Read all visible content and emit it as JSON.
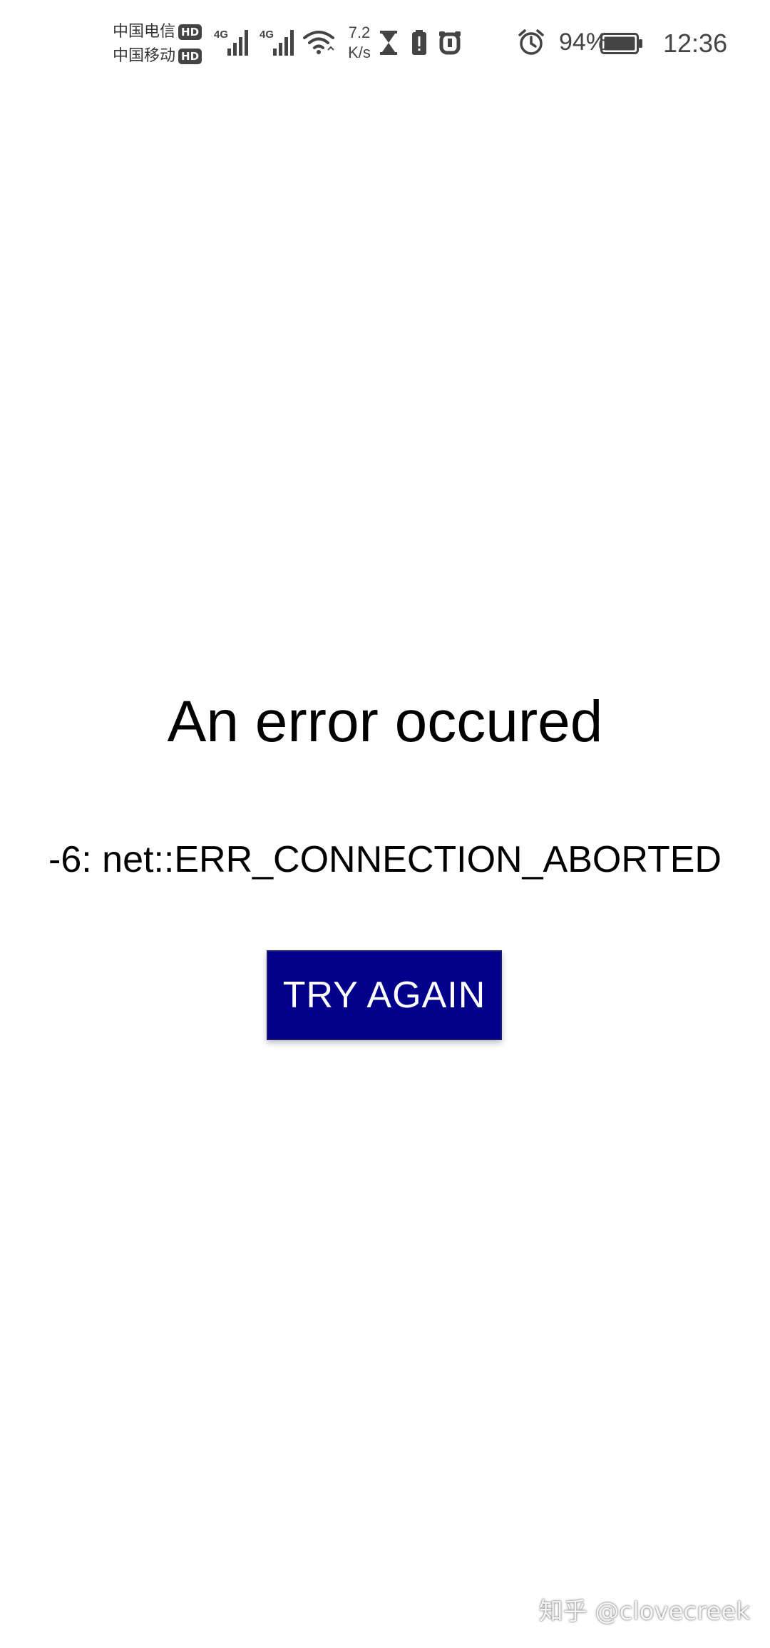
{
  "status_bar": {
    "carrier_1": "中国电信",
    "carrier_2": "中国移动",
    "hd_badge": "HD",
    "network_type_1": "4G",
    "network_type_2": "4G",
    "net_speed_value": "7.2",
    "net_speed_unit": "K/s",
    "battery_percent": "94%",
    "time": "12:36",
    "icons": [
      "signal-icon",
      "signal-icon",
      "wifi-icon",
      "hourglass-icon",
      "battery-alert-icon",
      "app-notification-icon",
      "alarm-icon",
      "battery-icon"
    ]
  },
  "error": {
    "title": "An error occured",
    "code": "-6: net::ERR_CONNECTION_ABORTED",
    "button_label": "TRY AGAIN"
  },
  "watermark": {
    "text": "知乎 @clovecreek"
  },
  "colors": {
    "button_background": "#00008b",
    "button_text": "#ffffff",
    "background": "#ffffff",
    "text": "#000000"
  }
}
